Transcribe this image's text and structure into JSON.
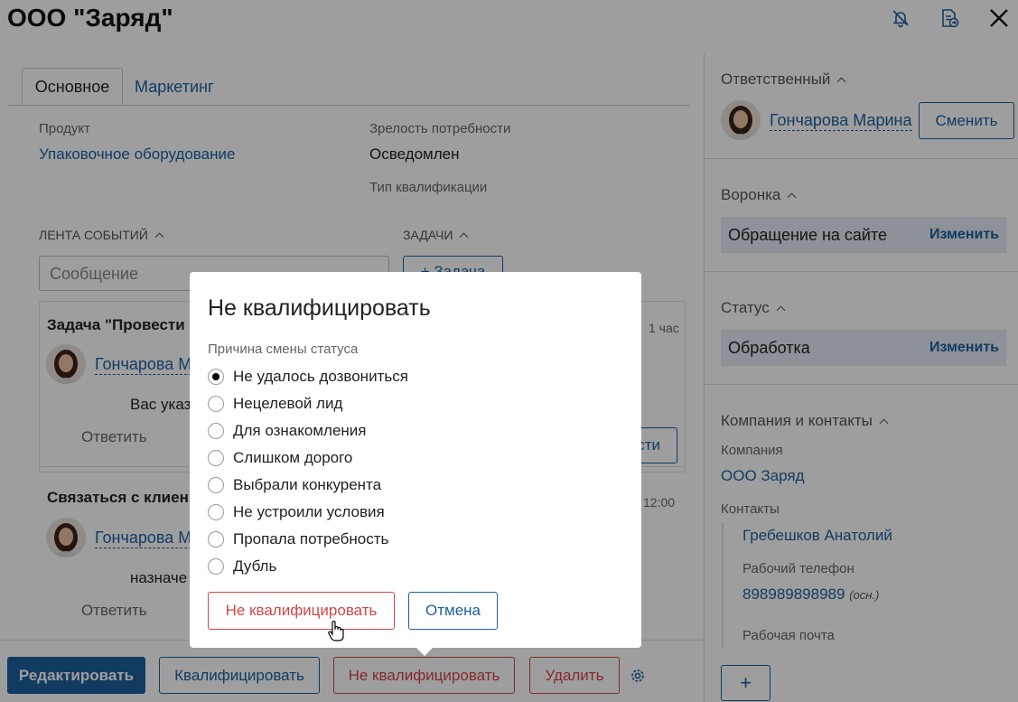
{
  "header": {
    "title": "ООО \"Заряд\""
  },
  "tabs": [
    {
      "label": "Основное"
    },
    {
      "label": "Маркетинг"
    }
  ],
  "fields": {
    "product_label": "Продукт",
    "product_value": "Упаковочное оборудование",
    "maturity_label": "Зрелость потребности",
    "maturity_value": "Осведомлен",
    "qualification_label": "Тип квалификации"
  },
  "feed": {
    "title": "ЛЕНТА СОБЫТИЙ",
    "message_placeholder": "Сообщение",
    "tasks_title": "ЗАДАЧИ",
    "add_task_label": "+ Задача",
    "items": [
      {
        "title": "Задача \"Провести",
        "user": "Гончарова М",
        "text": "Вас указ",
        "reply": "Ответить",
        "time": "1 час",
        "action": "сти"
      },
      {
        "title": "Связаться с клиен",
        "user": "Гончарова М",
        "text": "назначе",
        "reply": "Ответить",
        "time": "12:00"
      }
    ]
  },
  "right": {
    "responsible_title": "Ответственный",
    "responsible_name": "Гончарова Марина",
    "change_button": "Сменить",
    "funnel_title": "Воронка",
    "funnel_value": "Обращение на сайте",
    "funnel_action": "Изменить",
    "status_title": "Статус",
    "status_value": "Обработка",
    "status_action": "Изменить",
    "company_section_title": "Компания и контакты",
    "company_label": "Компания",
    "company_value": "ООО Заряд",
    "contacts_label": "Контакты",
    "contact_name": "Гребешков Анатолий",
    "phone_label": "Рабочий телефон",
    "phone_value": "898989898989",
    "phone_note": "(осн.)",
    "email_label": "Рабочая почта",
    "add_label": "+"
  },
  "footer": {
    "edit": "Редактировать",
    "qualify": "Квалифицировать",
    "disqualify": "Не квалифицировать",
    "delete": "Удалить"
  },
  "modal": {
    "title": "Не квалифицировать",
    "reason_label": "Причина смены статуса",
    "options": [
      {
        "label": "Не удалось дозвониться",
        "selected": true
      },
      {
        "label": "Нецелевой лид",
        "selected": false
      },
      {
        "label": "Для ознакомления",
        "selected": false
      },
      {
        "label": "Слишком дорого",
        "selected": false
      },
      {
        "label": "Выбрали конкурента",
        "selected": false
      },
      {
        "label": "Не устроили условия",
        "selected": false
      },
      {
        "label": "Пропала потребность",
        "selected": false
      },
      {
        "label": "Дубль",
        "selected": false
      }
    ],
    "confirm": "Не квалифицировать",
    "cancel": "Отмена"
  },
  "colors": {
    "accent": "#1e5f9e",
    "danger": "#d64545",
    "highlight": "#e3ecf4"
  }
}
